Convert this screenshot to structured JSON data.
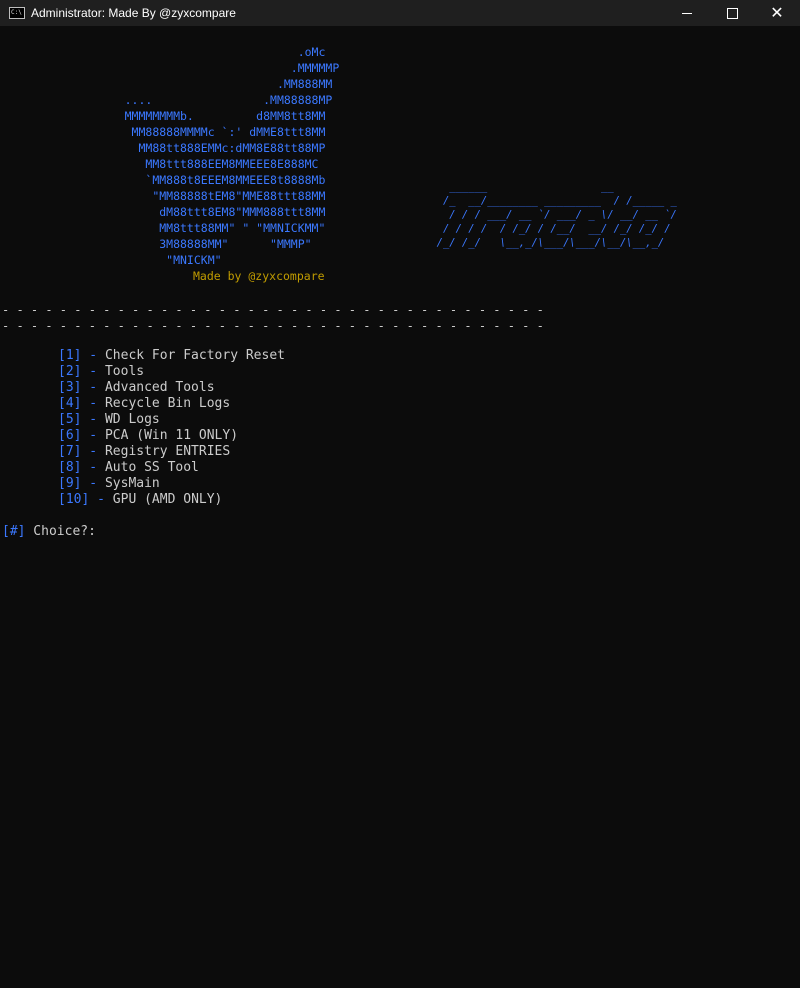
{
  "window": {
    "title": "Administrator:  Made By @zyxcompare"
  },
  "colors": {
    "background": "#0c0c0c",
    "accent_blue": "#3b78ff",
    "gold": "#c19c00",
    "text": "#cccccc"
  },
  "icons": [
    "console-icon",
    "minimize-icon",
    "maximize-icon",
    "close-icon"
  ],
  "logo_art": "                                           .oMc\n                                          .MMMMMP\n                                        .MM888MM\n                  ....                .MM88888MP\n                  MMMMMMMMb.         d8MM8tt8MM\n                   MM88888MMMMc `:' dMME8ttt8MM\n                    MM88tt888EMMc:dMM8E88tt88MP\n                     MM8ttt888EEM8MMEEE8E888MC\n                     `MM888t8EEEM8MMEEE8t8888Mb\n                      \"MM88888tEM8\"MME88ttt88MM\n                       dM88ttt8EM8\"MMM888ttt8MM\n                       MM8ttt88MM\" \" \"MMNICKMM\"\n                       3M88888MM\"      \"MMMP\"\n                        \"MNICKM\"",
  "made_by": "Made by @zyxcompare",
  "banner_art": "    ______                  __        \n   /_  __/________ _________  / /_____ _\n    / / / ___/ __ `/ ___/ _ \\/ __/ __ `/\n   / / / /  / /_/ / /__/  __/ /_/ /_/ / \n  /_/ /_/   \\__,_/\\___/\\___/\\__/\\__,_/  ",
  "divider_line": "- - - - - - - - - - - - - - - - - - - - - - - - - - - - - - - - - - - - - -",
  "menu": [
    {
      "num": "[1]",
      "label": "Check For Factory Reset"
    },
    {
      "num": "[2]",
      "label": "Tools"
    },
    {
      "num": "[3]",
      "label": "Advanced Tools"
    },
    {
      "num": "[4]",
      "label": "Recycle Bin Logs"
    },
    {
      "num": "[5]",
      "label": "WD Logs"
    },
    {
      "num": "[6]",
      "label": "PCA (Win 11 ONLY)"
    },
    {
      "num": "[7]",
      "label": "Registry ENTRIES"
    },
    {
      "num": "[8]",
      "label": "Auto SS Tool"
    },
    {
      "num": "[9]",
      "label": "SysMain"
    },
    {
      "num": "[10]",
      "label": "GPU (AMD ONLY)"
    }
  ],
  "menu_separator": " - ",
  "prompt": {
    "tag": "[#]",
    "text": " Choice?:"
  }
}
